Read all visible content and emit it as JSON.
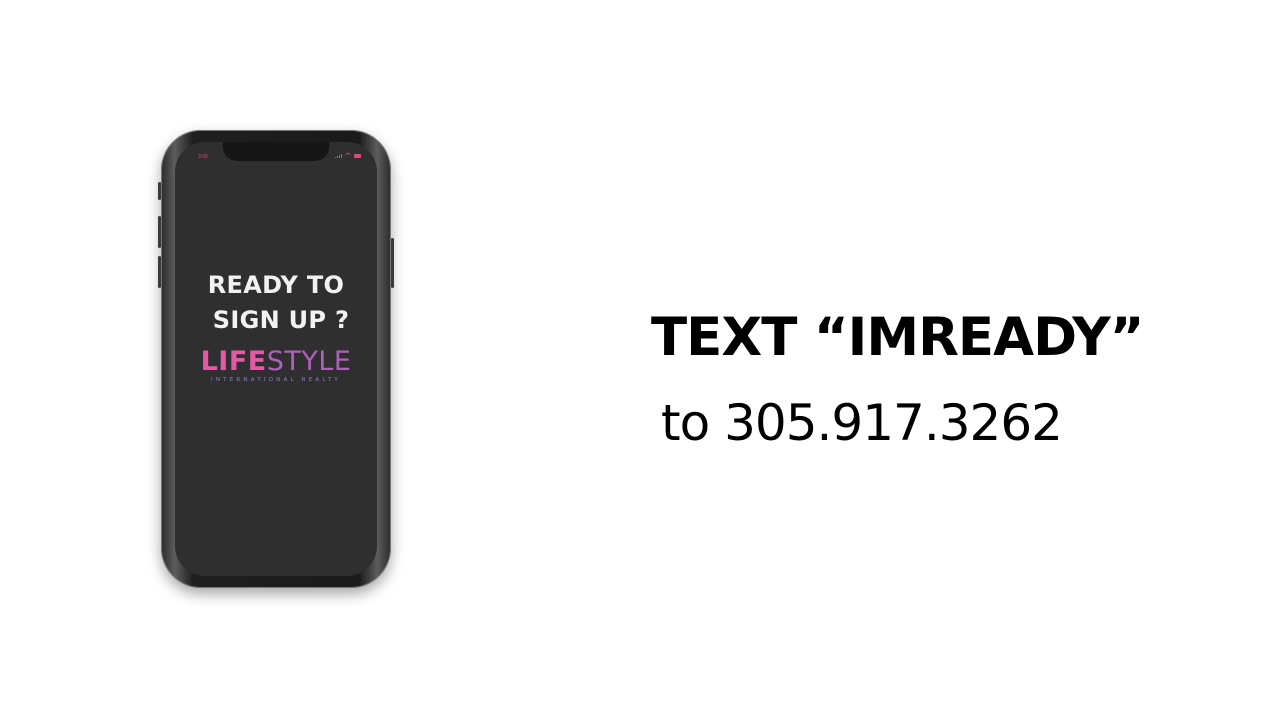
{
  "phone": {
    "status_time": "3:05",
    "heading_line1": "READY TO",
    "heading_line2": "SIGN UP ?",
    "brand_bold": "LIFE",
    "brand_light": "STYLE",
    "brand_tagline": "INTERNATIONAL REALTY",
    "icons": [
      "signal-icon",
      "wifi-icon",
      "battery-icon"
    ]
  },
  "cta": {
    "title": "TEXT “IMREADY”",
    "number_line": "to 305.917.3262"
  },
  "colors": {
    "background": "#ffffff",
    "screen": "#2f2f2f",
    "brand_pink": "#e55aa8",
    "brand_purple": "#b15fbf",
    "text": "#000000"
  }
}
